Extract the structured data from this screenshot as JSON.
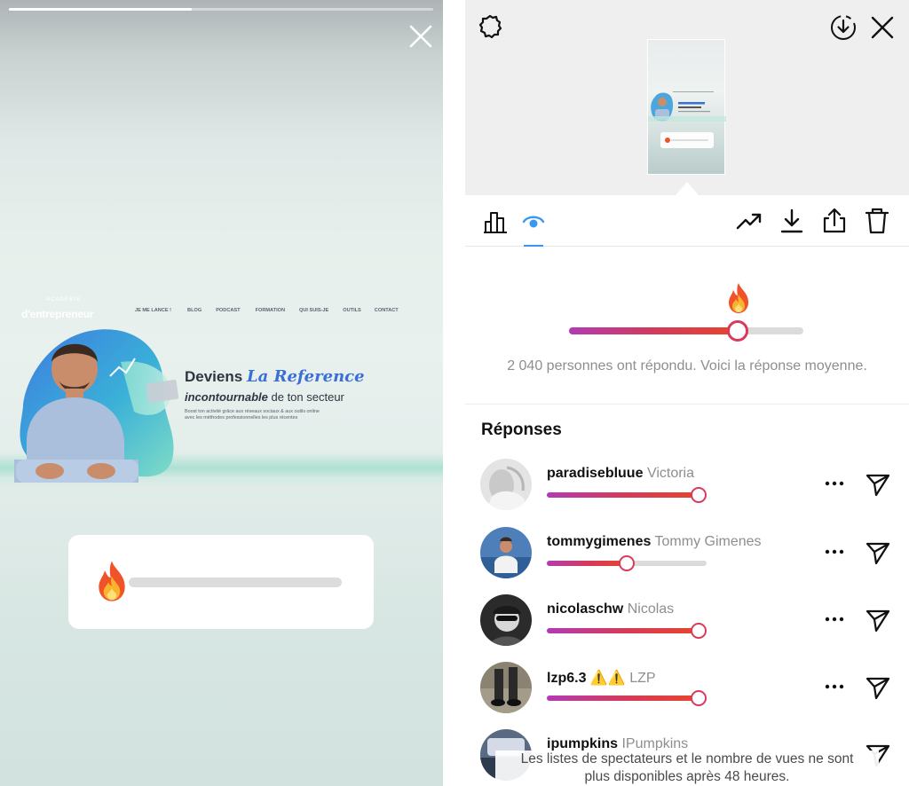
{
  "story": {
    "progress_percent": 43,
    "website": {
      "logo_text": "d'entrepreneur",
      "logo_sup": "ACADÉMIE",
      "nav": [
        "JE ME LANCE !",
        "BLOG",
        "PODCAST",
        "FORMATION",
        "QUI SUIS-JE",
        "OUTILS",
        "CONTACT"
      ],
      "headline_prefix": "Deviens",
      "headline_script": "La Reference",
      "sub_bold": "incontournable",
      "sub_rest": " de ton secteur",
      "desc_line1": "Boost ton activité grâce aux réseaux sociaux & aux outils online",
      "desc_line2": "avec les méthodes professionnelles les plus récentes"
    },
    "slider_emoji": "fire-emoji"
  },
  "panel": {
    "average_caption": "2 040 personnes ont répondu. Voici la réponse moyenne.",
    "average_value_percent": 72,
    "responses_title": "Réponses",
    "responses": [
      {
        "username": "paradisebluue",
        "full_name": "Victoria",
        "value_percent": 95
      },
      {
        "username": "tommygimenes",
        "full_name": "Tommy Gimenes",
        "value_percent": 50
      },
      {
        "username": "nicolaschw",
        "full_name": "Nicolas",
        "value_percent": 95
      },
      {
        "username": "lzp6.3 ⚠️⚠️",
        "full_name": "LZP",
        "value_percent": 95
      },
      {
        "username": "ipumpkins",
        "full_name": "IPumpkins",
        "value_percent": 0
      }
    ],
    "footer_note_line1": "Les listes de spectateurs et le nombre de vues ne sont",
    "footer_note_line2": "plus disponibles après 48 heures.",
    "accent_color": "#3897f0",
    "slider_gradient": [
      "#b33ab4",
      "#d13a5c",
      "#e8442c"
    ]
  }
}
